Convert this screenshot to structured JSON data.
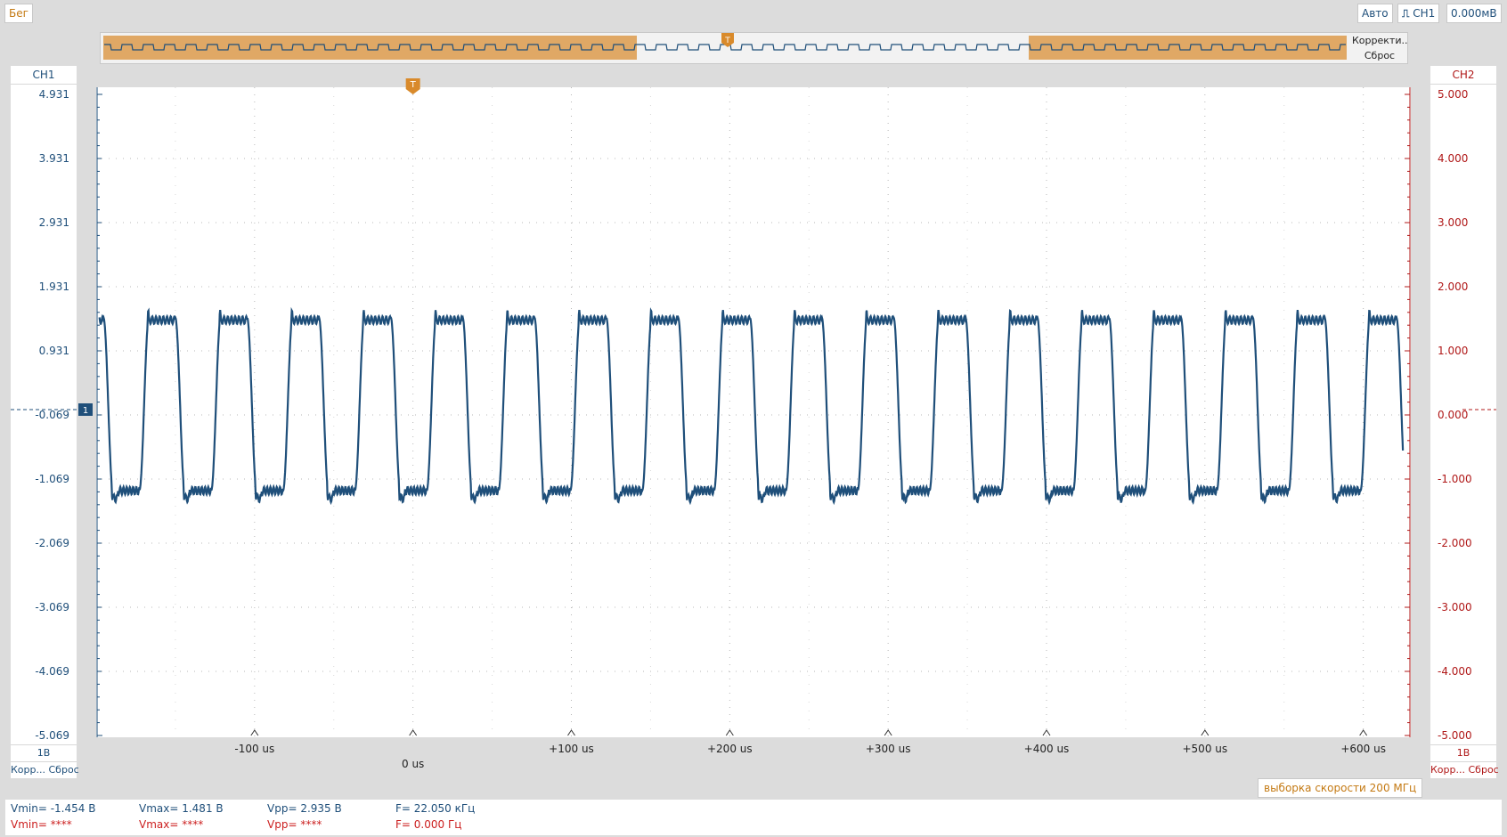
{
  "toolbar": {
    "run_label": "Бег",
    "trigger_mode": "Авто",
    "trigger_source": "CH1",
    "trigger_level": "0.000мВ"
  },
  "overview": {
    "correct_label": "Корректи...",
    "reset_label": "Сброс",
    "trigger_marker": "T"
  },
  "ch1": {
    "title": "CH1",
    "ticks": [
      "4.931",
      "3.931",
      "2.931",
      "1.931",
      "0.931",
      "-0.069",
      "-1.069",
      "-2.069",
      "-3.069",
      "-4.069",
      "-5.069"
    ],
    "scale": "1В",
    "corr_reset": "Корр... Сброс",
    "color": "#1f4f7a",
    "offset_marker": "1"
  },
  "ch2": {
    "title": "CH2",
    "ticks": [
      "5.000",
      "4.000",
      "3.000",
      "2.000",
      "1.000",
      "0.000",
      "-1.000",
      "-2.000",
      "-3.000",
      "-4.000",
      "-5.000"
    ],
    "scale": "1В",
    "corr_reset": "Корр... Сброс",
    "color": "#b01818"
  },
  "plot": {
    "trigger_marker": "T",
    "x_labels": [
      "-100 us",
      "0 us",
      "+100 us",
      "+200 us",
      "+300 us",
      "+400 us",
      "+500 us",
      "+600 us"
    ]
  },
  "sample_rate": "выборка скорости 200 МГц",
  "measurements": {
    "ch1": {
      "vmin": "Vmin= -1.454 В",
      "vmax": "Vmax= 1.481 В",
      "vpp": "Vpp= 2.935 В",
      "freq": "F= 22.050 кГц"
    },
    "ch2": {
      "vmin": "Vmin= ****",
      "vmax": "Vmax= ****",
      "vpp": "Vpp= ****",
      "freq": "F= 0.000 Гц"
    }
  },
  "chart_data": {
    "type": "line",
    "series": [
      {
        "name": "CH1",
        "frequency_khz": 22.05,
        "vmin": -1.454,
        "vmax": 1.481,
        "high_level": 1.45,
        "low_level": -1.25
      }
    ],
    "x_unit": "us",
    "xlim": [
      -200,
      630
    ],
    "y_ch1_range": [
      -5.069,
      4.931
    ],
    "y_ch2_range": [
      -5.0,
      5.0
    ],
    "x_ticks": [
      -100,
      0,
      100,
      200,
      300,
      400,
      500,
      600
    ],
    "grid": true,
    "colors": {
      "ch1": "#1f4f7a",
      "ch2": "#b01818",
      "trigger": "#d98a2b"
    }
  }
}
